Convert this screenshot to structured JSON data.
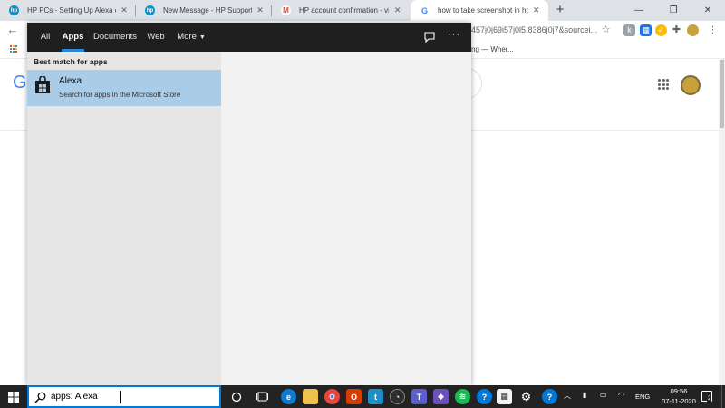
{
  "browser": {
    "tabs": [
      {
        "title": "HP PCs - Setting Up Alexa on Wi",
        "favicon": "hp-icon",
        "favicon_color": "#0096d6"
      },
      {
        "title": "New Message - HP Support Com",
        "favicon": "hp-icon",
        "favicon_color": "#0096d6"
      },
      {
        "title": "HP account confirmation - visva",
        "favicon": "gmail-icon",
        "favicon_color": "#ea4335"
      },
      {
        "title": "how to take screenshot in hp lap",
        "favicon": "google-icon",
        "favicon_color": "#4285f4"
      }
    ],
    "address_fragment": "457j0j69i57j0l5.8386j0j7&sourcei...",
    "bookmark_fragment": "ng — Wher...",
    "page_logo_letter": "G"
  },
  "search_flyout": {
    "nav_tabs": [
      "All",
      "Apps",
      "Documents",
      "Web",
      "More"
    ],
    "active_tab": "Apps",
    "best_match_heading": "Best match for apps",
    "result": {
      "title": "Alexa",
      "subtitle": "Search for apps in the Microsoft Store",
      "icon": "microsoft-store-icon"
    },
    "colors": {
      "nav_bg": "#1f1f1f",
      "accent": "#2b88d8",
      "selected_bg": "#a9cde9"
    }
  },
  "taskbar": {
    "search_query": "apps: Alexa",
    "apps": [
      "cortana-icon",
      "task-view-icon",
      "edge-icon",
      "file-explorer-icon",
      "chrome-icon",
      "office-icon",
      "photos-icon",
      "twitter-icon",
      "speedometer-icon",
      "teams-icon",
      "gaming-icon",
      "spotify-icon",
      "help-icon",
      "store-icon",
      "settings-icon",
      "help-icon"
    ],
    "tray": {
      "language": "ENG",
      "time": "09:56",
      "date": "07-11-2020",
      "notification_count": "2"
    },
    "colors": {
      "bg": "#232323",
      "search_border": "#0078d7"
    }
  }
}
